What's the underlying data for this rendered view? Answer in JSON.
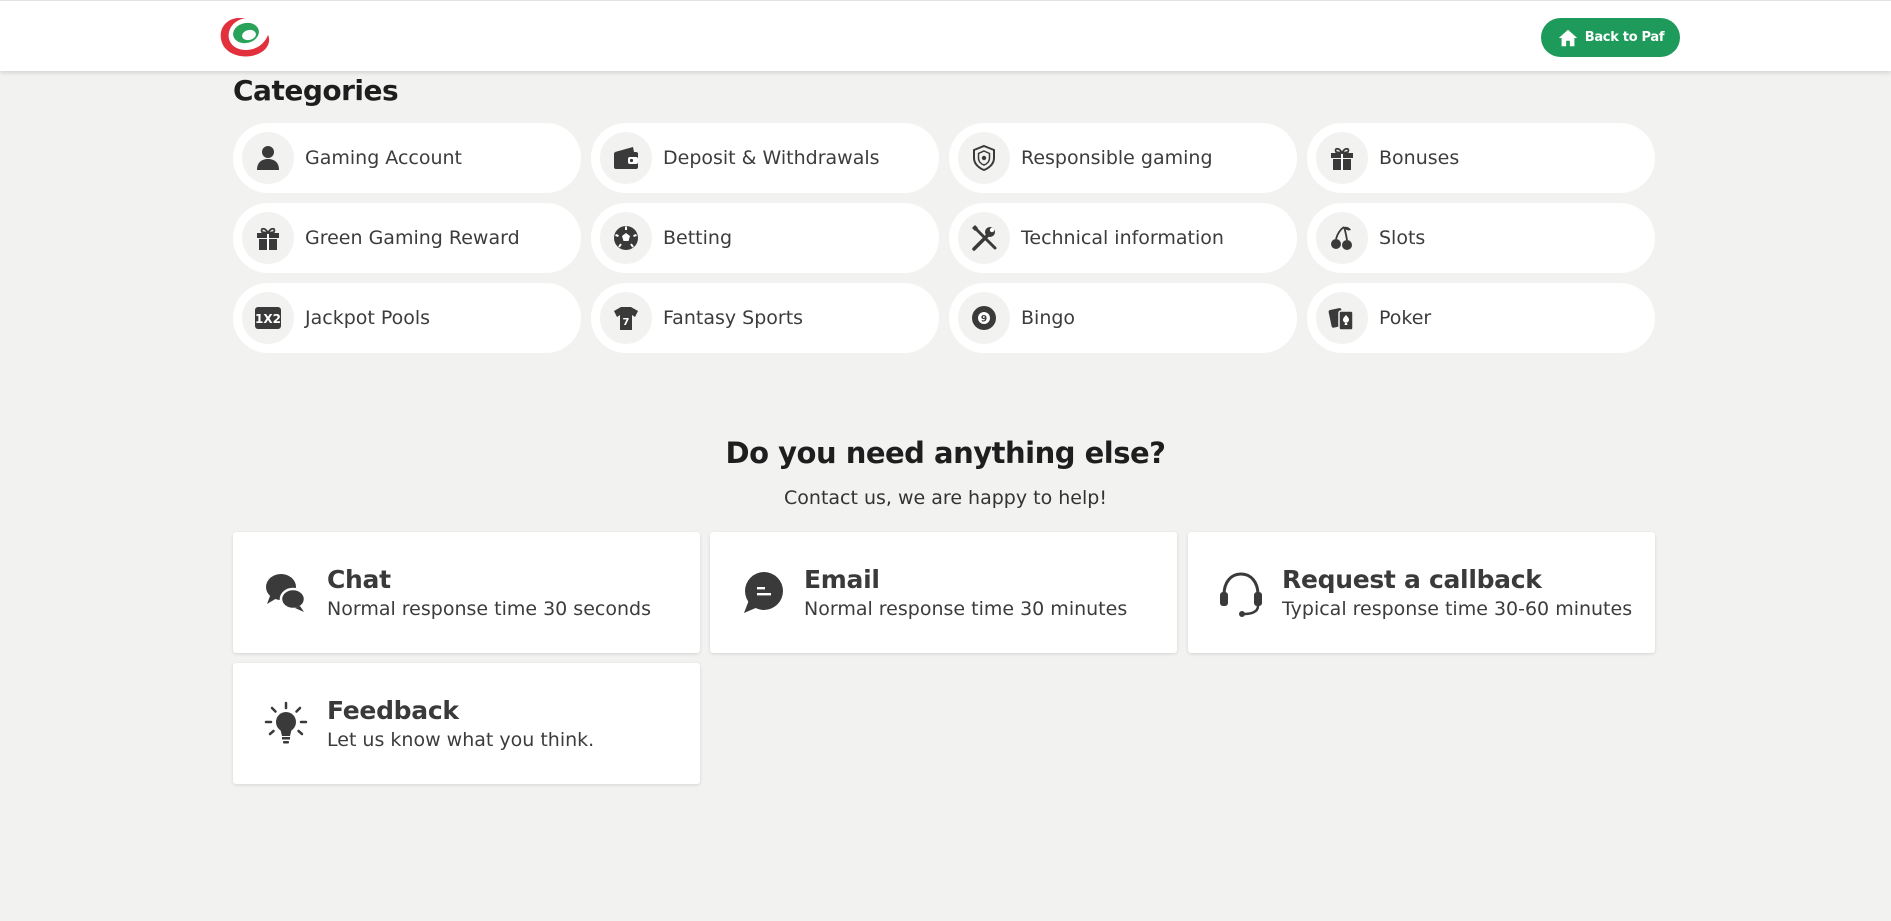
{
  "header": {
    "back_label": "Back to Paf",
    "brand_colors": {
      "logo_red": "#e2313c",
      "logo_green": "#2aa35a",
      "button_green": "#1e9a5a"
    }
  },
  "categories": {
    "title": "Categories",
    "items": [
      {
        "label": "Gaming Account",
        "icon": "person-icon"
      },
      {
        "label": "Deposit & Withdrawals",
        "icon": "wallet-icon"
      },
      {
        "label": "Responsible gaming",
        "icon": "shield-icon"
      },
      {
        "label": "Bonuses",
        "icon": "gift-icon"
      },
      {
        "label": "Green Gaming Reward",
        "icon": "gift-icon"
      },
      {
        "label": "Betting",
        "icon": "soccer-ball-icon"
      },
      {
        "label": "Technical information",
        "icon": "tools-icon"
      },
      {
        "label": "Slots",
        "icon": "cherries-icon"
      },
      {
        "label": "Jackpot Pools",
        "icon": "1x2-icon",
        "icon_text": "1X2"
      },
      {
        "label": "Fantasy Sports",
        "icon": "jersey-icon",
        "icon_text": "7"
      },
      {
        "label": "Bingo",
        "icon": "bingo-ball-icon",
        "icon_text": "9"
      },
      {
        "label": "Poker",
        "icon": "cards-icon"
      }
    ]
  },
  "help": {
    "title": "Do you need anything else?",
    "subtitle": "Contact us, we are happy to help!",
    "contacts": [
      {
        "title": "Chat",
        "desc": "Normal response time 30 seconds",
        "icon": "chat-bubbles-icon"
      },
      {
        "title": "Email",
        "desc": "Normal response time 30 minutes",
        "icon": "message-bubble-icon"
      },
      {
        "title": "Request a callback",
        "desc": "Typical response time 30-60 minutes",
        "icon": "headset-icon"
      },
      {
        "title": "Feedback",
        "desc": "Let us know what you think.",
        "icon": "lightbulb-icon"
      }
    ]
  }
}
